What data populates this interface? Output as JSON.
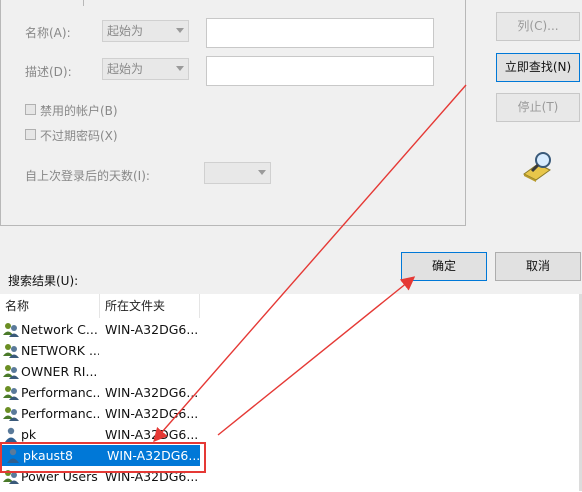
{
  "form": {
    "name_label": "名称(A):",
    "name_mode": "起始为",
    "desc_label": "描述(D):",
    "desc_mode": "起始为",
    "disabled_accounts_label": "禁用的帐户(B)",
    "no_expire_password_label": "不过期密码(X)",
    "days_since_login_label": "自上次登录后的天数(I):"
  },
  "buttons": {
    "columns": "列(C)...",
    "find_now": "立即查找(N)",
    "stop": "停止(T)",
    "ok": "确定",
    "cancel": "取消"
  },
  "results": {
    "label": "搜索结果(U):",
    "columns": [
      "名称",
      "所在文件夹"
    ],
    "rows": [
      {
        "name": "Network C...",
        "folder": "WIN-A32DG6...",
        "icon": "group-icon"
      },
      {
        "name": "NETWORK ...",
        "folder": "",
        "icon": "group-icon"
      },
      {
        "name": "OWNER RI...",
        "folder": "",
        "icon": "group-icon"
      },
      {
        "name": "Performanc...",
        "folder": "WIN-A32DG6...",
        "icon": "group-icon"
      },
      {
        "name": "Performanc...",
        "folder": "WIN-A32DG6...",
        "icon": "group-icon"
      },
      {
        "name": "pk",
        "folder": "WIN-A32DG6...",
        "icon": "user-icon"
      },
      {
        "name": "pkaust8",
        "folder": "WIN-A32DG6...",
        "icon": "user-icon",
        "selected": true
      },
      {
        "name": "Power Users",
        "folder": "WIN-A32DG6...",
        "icon": "group-icon"
      }
    ]
  },
  "colors": {
    "selection": "#0078d7",
    "annotation": "#e53935"
  }
}
